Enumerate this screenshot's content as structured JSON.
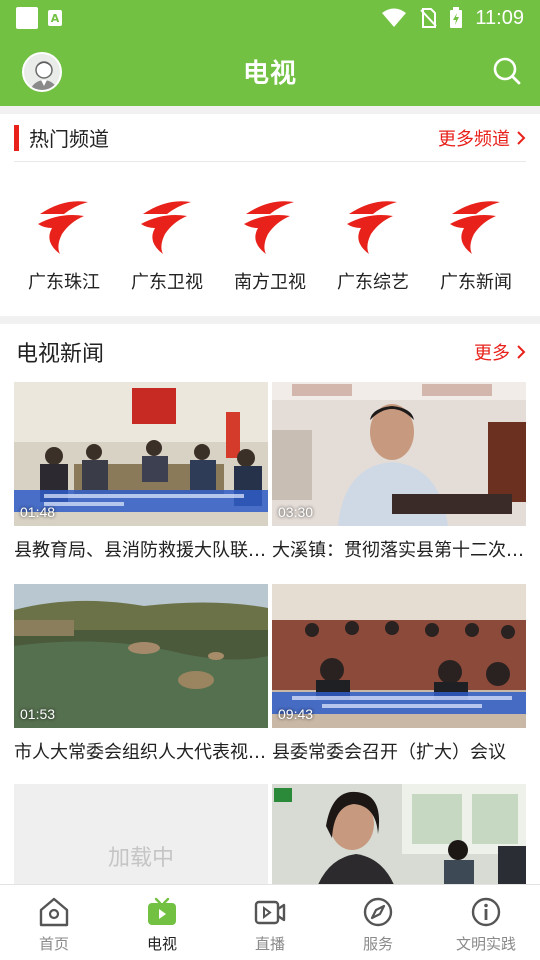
{
  "status_bar": {
    "time": "11:09"
  },
  "header": {
    "title": "电视"
  },
  "hot_channels": {
    "title": "热门频道",
    "more_label": "更多频道",
    "accent": "#e8221b",
    "channels": [
      {
        "name": "广东珠江"
      },
      {
        "name": "广东卫视"
      },
      {
        "name": "南方卫视"
      },
      {
        "name": "广东综艺"
      },
      {
        "name": "广东新闻"
      }
    ]
  },
  "tv_news": {
    "title": "电视新闻",
    "more_label": "更多",
    "items": [
      {
        "title": "县教育局、县消防救援大队联合开展消防安全进校园活动",
        "duration": "01:48"
      },
      {
        "title": "大溪镇：贯彻落实县第十二次党代会精神",
        "duration": "03:30"
      },
      {
        "title": "市人大常委会组织人大代表视察工作",
        "duration": "01:53"
      },
      {
        "title": "县委常委会召开（扩大）会议",
        "duration": "09:43"
      },
      {
        "loading_label": "加载中"
      },
      {}
    ]
  },
  "bottom_nav": {
    "items": [
      {
        "label": "首页",
        "icon": "home-icon"
      },
      {
        "label": "电视",
        "icon": "tv-icon",
        "active": true
      },
      {
        "label": "直播",
        "icon": "live-camera-icon"
      },
      {
        "label": "服务",
        "icon": "compass-icon"
      },
      {
        "label": "文明实践",
        "icon": "info-icon"
      }
    ],
    "active_color": "#72c143"
  },
  "colors": {
    "brand_green": "#72c143",
    "accent_red": "#e8221b"
  }
}
